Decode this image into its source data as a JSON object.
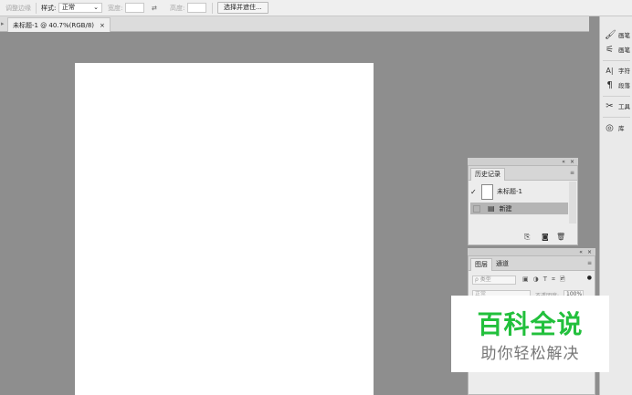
{
  "options_bar": {
    "refine_edge_label": "调整边缘",
    "style_label": "样式:",
    "style_value": "正常",
    "width_label": "宽度:",
    "swap_icon": "swap-arrows-icon",
    "height_label": "高度:",
    "select_mask_button": "选择并遮住..."
  },
  "document_tab": {
    "title": "未标题-1 @ 40.7%(RGB/8)",
    "close": "×"
  },
  "dock": {
    "items": [
      {
        "icon": "brush-icon",
        "glyph": "🖌",
        "label": "画笔"
      },
      {
        "icon": "brush-settings-icon",
        "glyph": "⚟",
        "label": "画笔"
      },
      {
        "icon": "character-icon",
        "glyph": "A|",
        "label": "字符"
      },
      {
        "icon": "paragraph-icon",
        "glyph": "¶",
        "label": "段落"
      },
      {
        "icon": "tool-presets-icon",
        "glyph": "✂",
        "label": "工具"
      },
      {
        "icon": "libraries-icon",
        "glyph": "◎",
        "label": "库"
      }
    ]
  },
  "history_panel": {
    "collapse": "«",
    "close": "×",
    "tab_label": "历史记录",
    "snapshot_name": "未标题-1",
    "steps": [
      {
        "label": "新建",
        "selected": true
      }
    ],
    "footer_icons": [
      "new-document-from-state-icon",
      "camera-icon",
      "trash-icon"
    ],
    "footer_glyphs": [
      "⎘",
      "◙",
      "🗑"
    ]
  },
  "layers_panel": {
    "collapse": "«",
    "close": "×",
    "tabs": [
      {
        "label": "图层",
        "active": true
      },
      {
        "label": "通道",
        "active": false
      }
    ],
    "filter_label": "ρ 类型",
    "filter_icons": [
      "▣",
      "◑",
      "T",
      "⌗",
      "🖻"
    ],
    "blend_mode": "正常",
    "opacity_label": "不透明度:",
    "opacity_value": "100%"
  },
  "watermark": {
    "title": "百科全说",
    "subtitle": "助你轻松解决",
    "color": "#22c03c"
  }
}
